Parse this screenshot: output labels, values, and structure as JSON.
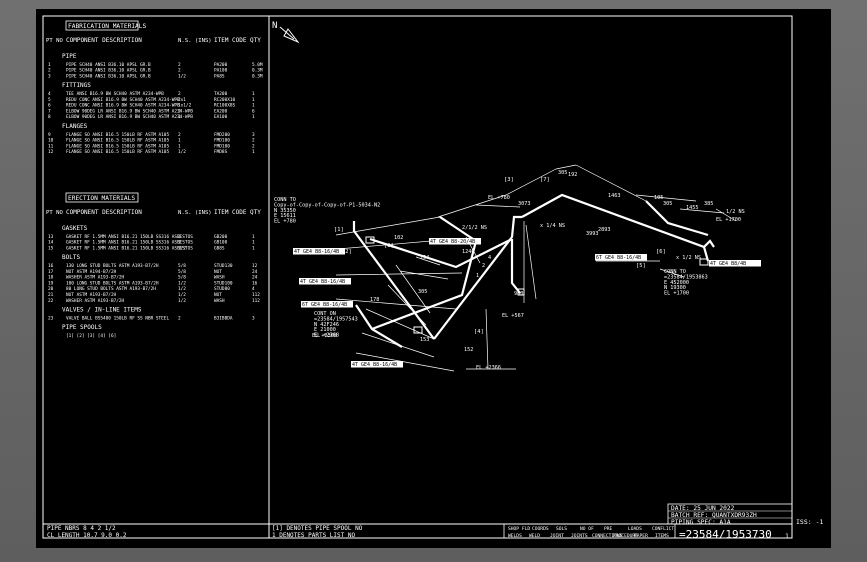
{
  "sheet": {
    "north": "N",
    "fabrication": {
      "title": "FABRICATION MATERIALS",
      "pt_no": "PT NO",
      "col_component": "COMPONENT DESCRIPTION",
      "col_ns": "N.S. (INS)",
      "col_item": "ITEM CODE",
      "col_qty": "QTY",
      "sections": [
        {
          "title": "PIPE",
          "rows": [
            {
              "pt": "1",
              "desc": "PIPE SCH40 ANSI B36.10 APSL GR.B",
              "ns": "2",
              "item": "PA200",
              "qty": "5.0M"
            },
            {
              "pt": "2",
              "desc": "PIPE SCH40 ANSI B36.10 APSL GR.B",
              "ns": "2",
              "item": "PA100",
              "qty": "0.3M"
            },
            {
              "pt": "3",
              "desc": "PIPE SCH40 ANSI B36.10 APSL GR.B",
              "ns": "1/2",
              "item": "PA8S",
              "qty": "0.3M"
            }
          ]
        },
        {
          "title": "FITTINGS",
          "rows": [
            {
              "pt": "4",
              "desc": "TEE ANSI B16.9 BW SCH40 ASTM A234-WPB",
              "ns": "2",
              "item": "TA200",
              "qty": "1"
            },
            {
              "pt": "5",
              "desc": "REDU CONC ANSI B16.9 BW SCH40 ASTM A234-WPB",
              "ns": "2x1",
              "item": "RC200X10",
              "qty": "1"
            },
            {
              "pt": "6",
              "desc": "REDU CONC ANSI B16.9 BW SCH40 ASTM A234-WPB",
              "ns": "1x1/2",
              "item": "RC100X8S",
              "qty": "1"
            },
            {
              "pt": "7",
              "desc": "ELBOW 90DEG LR ANSI B16.9 BW SCH40 ASTM A234-WPB",
              "ns": "2",
              "item": "EA200",
              "qty": "6"
            },
            {
              "pt": "8",
              "desc": "ELBOW 90DEG LR ANSI B16.9 BW SCH40 ASTM A234-WPB",
              "ns": "1",
              "item": "EA100",
              "qty": "1"
            }
          ]
        },
        {
          "title": "FLANGES",
          "rows": [
            {
              "pt": "9",
              "desc": "FLANGE SO ANSI B16.5 150LB RF ASTM A105",
              "ns": "2",
              "item": "FMD200",
              "qty": "3"
            },
            {
              "pt": "10",
              "desc": "FLANGE SO ANSI B16.5 150LB RF ASTM A105",
              "ns": "1",
              "item": "FMD100",
              "qty": "2"
            },
            {
              "pt": "11",
              "desc": "FLANGE SO ANSI B16.5 150LB RF ASTM A105",
              "ns": "1",
              "item": "FMD100",
              "qty": "2"
            },
            {
              "pt": "12",
              "desc": "FLANGE SO ANSI B16.5 150LB RF ASTM A105",
              "ns": "1/2",
              "item": "FMD8S",
              "qty": "1"
            }
          ]
        }
      ]
    },
    "erection": {
      "title": "ERECTION MATERIALS",
      "pt_no": "PT NO",
      "col_component": "COMPONENT DESCRIPTION",
      "col_ns": "N.S. (INS)",
      "col_item": "ITEM CODE",
      "col_qty": "QTY",
      "sections": [
        {
          "title": "GASKETS",
          "rows": [
            {
              "pt": "13",
              "desc": "GASKET RF 1.5MM ANSI B16.21 150LB SS316 ASBESTOS",
              "ns": "2",
              "item": "GB200",
              "qty": "1"
            },
            {
              "pt": "14",
              "desc": "GASKET RF 1.5MM ANSI B16.21 150LB SS316 ASBESTOS",
              "ns": "1",
              "item": "GB100",
              "qty": "1"
            },
            {
              "pt": "15",
              "desc": "GASKET RF 1.5MM ANSI B16.21 150LB SS316 ASBESTOS",
              "ns": "1/2",
              "item": "GB8S",
              "qty": "1"
            }
          ]
        },
        {
          "title": "BOLTS",
          "rows": [
            {
              "pt": "16",
              "desc": "130 LONG STUD BOLTS ASTM A193-B7/2H",
              "ns": "5/8",
              "item": "STUD130",
              "qty": "12"
            },
            {
              "pt": "17",
              "desc": "NUT ASTM A194-B7/2H",
              "ns": "5/8",
              "item": "NUT",
              "qty": "24"
            },
            {
              "pt": "18",
              "desc": "WASHER ASTM A193-B7/2H",
              "ns": "5/8",
              "item": "WASH",
              "qty": "24"
            },
            {
              "pt": "19",
              "desc": "100 LONG STUD BOLTS ASTM A193-B7/2H",
              "ns": "1/2",
              "item": "STUD100",
              "qty": "16"
            },
            {
              "pt": "20",
              "desc": "80 LONG STUD BOLTS ASTM A193-B7/2H",
              "ns": "1/2",
              "item": "STUD80",
              "qty": "4"
            },
            {
              "pt": "21",
              "desc": "NUT ASTM A193-B7/2H",
              "ns": "1/2",
              "item": "NUT",
              "qty": "112"
            },
            {
              "pt": "22",
              "desc": "WASHER ASTM A193-B7/2H",
              "ns": "1/2",
              "item": "WASH",
              "qty": "112"
            }
          ]
        },
        {
          "title": "VALVES / IN-LINE ITEMS",
          "rows": [
            {
              "pt": "23",
              "desc": "VALVE BALL BS5480 150LB RF SS NBR STEEL",
              "ns": "2",
              "item": "B3IBBDA",
              "qty": "3"
            }
          ]
        },
        {
          "title": "PIPE SPOOLS",
          "rows": [
            {
              "pt": "",
              "desc": "[1] [2] [3] [4] [6]",
              "ns": "",
              "item": "",
              "qty": ""
            }
          ]
        }
      ]
    },
    "footer": {
      "pipe_nbrs": "PIPE NBRS   8    4    2 1/2",
      "cl_length": "CL LENGTH  10.7  9.0   0.2",
      "note1": "[1] DENOTES PIPE SPOOL NO",
      "note2": "1  DENOTES PARTS LIST NO",
      "col_heads": [
        "SHOP FLD",
        "COORDS",
        "SOLS",
        "NO OF",
        "PRE",
        "LOADS",
        "CONFLICT"
      ],
      "col_heads2": [
        "WELDS",
        "WELD",
        "JOINT",
        "JOINTS",
        "CONNECTIONS",
        "PROCEDURE",
        "PAPER",
        "ITEMS"
      ],
      "drawing_no": "=23584/1953730",
      "sheet_no": "1",
      "iss": "ISS: -1"
    },
    "title_block": {
      "date": "DATE: 25 JUN 2022",
      "batch_ref": "BATCH REF: QUANTXDR93ZH",
      "piping_spec": "PIPING SPEC: A1A"
    },
    "iso_labels": {
      "conn_to_1": [
        "CONN TO",
        "Copy-of-Copy-of-Copy-of-P1-5034-N2",
        "N 35350",
        "E 15611",
        "EL +780"
      ],
      "conn_to_2": [
        "CONN TO",
        "=23584/1953863",
        "E 452000",
        "N 19300",
        "EL +1700"
      ],
      "cont_on": [
        "CONT ON",
        "=23584/1957543",
        "N 42F246",
        "E 21000",
        "EL +2368"
      ],
      "spools": [
        "[1]",
        "[2]",
        "[3]",
        "[4]",
        "[5]",
        "[6]",
        "[7]",
        "[8]"
      ],
      "specs": [
        "4T GE4 B8-16/4B",
        "4T GE4 B8-16/4B",
        "6T GE4 B8-16/4B",
        "4T GE4 B8-20/4B",
        "4T GE4 B8-16/4B",
        "6T GE4 B8-16/4B",
        "4T GE4 B8/4B"
      ],
      "els": [
        "EL +780",
        "EL +2368",
        "EL +567",
        "EL +2366",
        "EL +1700"
      ],
      "dims": [
        "305",
        "192",
        "1463",
        "1246",
        "3073",
        "2893",
        "105",
        "385",
        "305",
        "4",
        "1455",
        "3993",
        "102",
        "154",
        "178",
        "2",
        "1",
        "153",
        "152",
        "900",
        "305",
        "2/1/2 NS",
        "1/2 NS",
        "x 1/2 NS",
        "x 1/4 NS",
        "x 1/2 NS"
      ]
    }
  }
}
